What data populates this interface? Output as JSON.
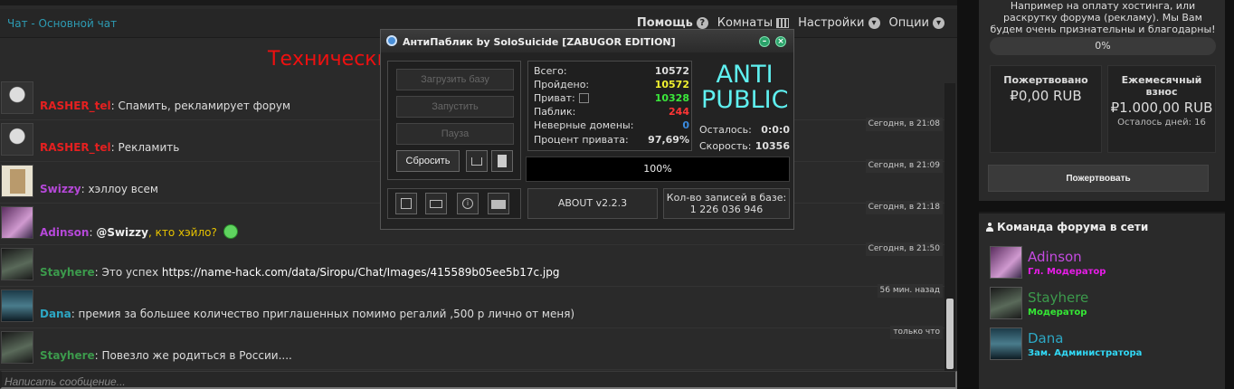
{
  "colors": {
    "accent_link": "#2d9bb3",
    "announce_red": "#ee1010",
    "user_red": "#e52020",
    "user_purple": "#b548d8",
    "user_green": "#3c9a4c",
    "user_blue": "#2da7c4",
    "mention_yellow": "#e6c200",
    "stat_yellow": "#f2f230",
    "stat_green": "#3be83b",
    "stat_red": "#ff3535",
    "stat_blue": "#3a8be0",
    "brand_cyan": "#5ff0f0"
  },
  "chat": {
    "title": "Чат - Основной чат",
    "nav": {
      "help": "Помощь",
      "help_icon": "question-circle-icon",
      "rooms": "Комнаты",
      "rooms_icon": "grid-icon",
      "settings": "Настройки",
      "settings_icon": "chevron-down-circle-icon",
      "options": "Опции",
      "options_icon": "chevron-down-circle-icon"
    },
    "announcement": "Технически",
    "input_placeholder": "Написать сообщение...",
    "messages": [
      {
        "time": "",
        "user": "RASHER_tel",
        "text": ": Спамить, рекламирует форум",
        "avatar": "rasher-avatar"
      },
      {
        "time": "Сегодня, в 21:08",
        "user": "RASHER_tel",
        "text": ": Рекламить",
        "avatar": "rasher-avatar"
      },
      {
        "time": "Сегодня, в 21:09",
        "user": "Swizzy",
        "text": ": хэллоу всем",
        "avatar": "swizzy-avatar"
      },
      {
        "time": "Сегодня, в 21:18",
        "user": "Adinson",
        "text": ": ",
        "mention": "@Swizzy",
        "extra": ", кто хэйло?",
        "emoji": "grin-emoji-icon",
        "avatar": "adinson-avatar"
      },
      {
        "time": "Сегодня, в 21:50",
        "user": "Stayhere",
        "text": ": Это успех ",
        "link": "https://name-hack.com/data/Siropu/Chat/Images/415589b05ee5b17c.jpg",
        "avatar": "stayhere-avatar"
      },
      {
        "time": "56 мин. назад",
        "user": "Dana",
        "text": ": премия за большее количество приглашенных помимо регалий ,500 р лично от меня)",
        "avatar": "dana-avatar"
      },
      {
        "time": "только что",
        "user": "Stayhere",
        "text": ": Повезло же родиться в России....",
        "avatar": "stayhere-avatar"
      }
    ]
  },
  "sidebar": {
    "message": "Например на оплату хостинга, или раскрутку форума (рекламу). Мы Вам будем очень признательны и благодарны!",
    "progress_label": "0%",
    "progress_value": 0,
    "donated_caption": "Пожертвовано",
    "donated_value": "₽0,00 RUB",
    "monthly_caption": "Ежемесячный взнос",
    "monthly_value": "₽1.000,00 RUB",
    "days_left": "Осталось дней: 16",
    "donate_button": "Пожертвовать",
    "team_title": "Команда форума в сети",
    "team_icon": "person-icon",
    "members": [
      {
        "name": "Adinson",
        "role": "Гл. Модератор",
        "name_color": "#c44be0",
        "role_color": "#e81ce8"
      },
      {
        "name": "Stayhere",
        "role": "Модератор",
        "name_color": "#3c9a4c",
        "role_color": "#35e835"
      },
      {
        "name": "Dana",
        "role": "Зам. Администратора",
        "name_color": "#2da7c4",
        "role_color": "#31d8f5"
      }
    ]
  },
  "antipublic": {
    "title": "АнтиПаблик by SoloSuicide [ZABUGOR EDITION]",
    "btn_load": "Загрузить базу",
    "btn_start": "Запустить",
    "btn_pause": "Пауза",
    "btn_reset": "Сбросить",
    "stats": [
      {
        "label": "Всего:",
        "value": "10572",
        "color": "#dddddd"
      },
      {
        "label": "Пройдено:",
        "value": "10572",
        "color": "#f2f230"
      },
      {
        "label": "Приват:",
        "value": "10328",
        "color": "#3be83b"
      },
      {
        "label": "Паблик:",
        "value": "244",
        "color": "#ff3535"
      },
      {
        "label": "Неверные домены:",
        "value": "0",
        "color": "#3a8be0"
      },
      {
        "label": "Процент привата:",
        "value": "97,69%",
        "color": "#dddddd"
      }
    ],
    "brand_line1": "ANTI",
    "brand_line2": "PUBLIC",
    "remaining_label": "Осталось:",
    "remaining_value": "0:0:0",
    "speed_label": "Скорость:",
    "speed_value": "10356",
    "progress_label": "100%",
    "progress_value": 100,
    "about": "ABOUT v2.2.3",
    "db_caption": "Кол-во записей в базе:",
    "db_value": "1 226 036 946"
  }
}
